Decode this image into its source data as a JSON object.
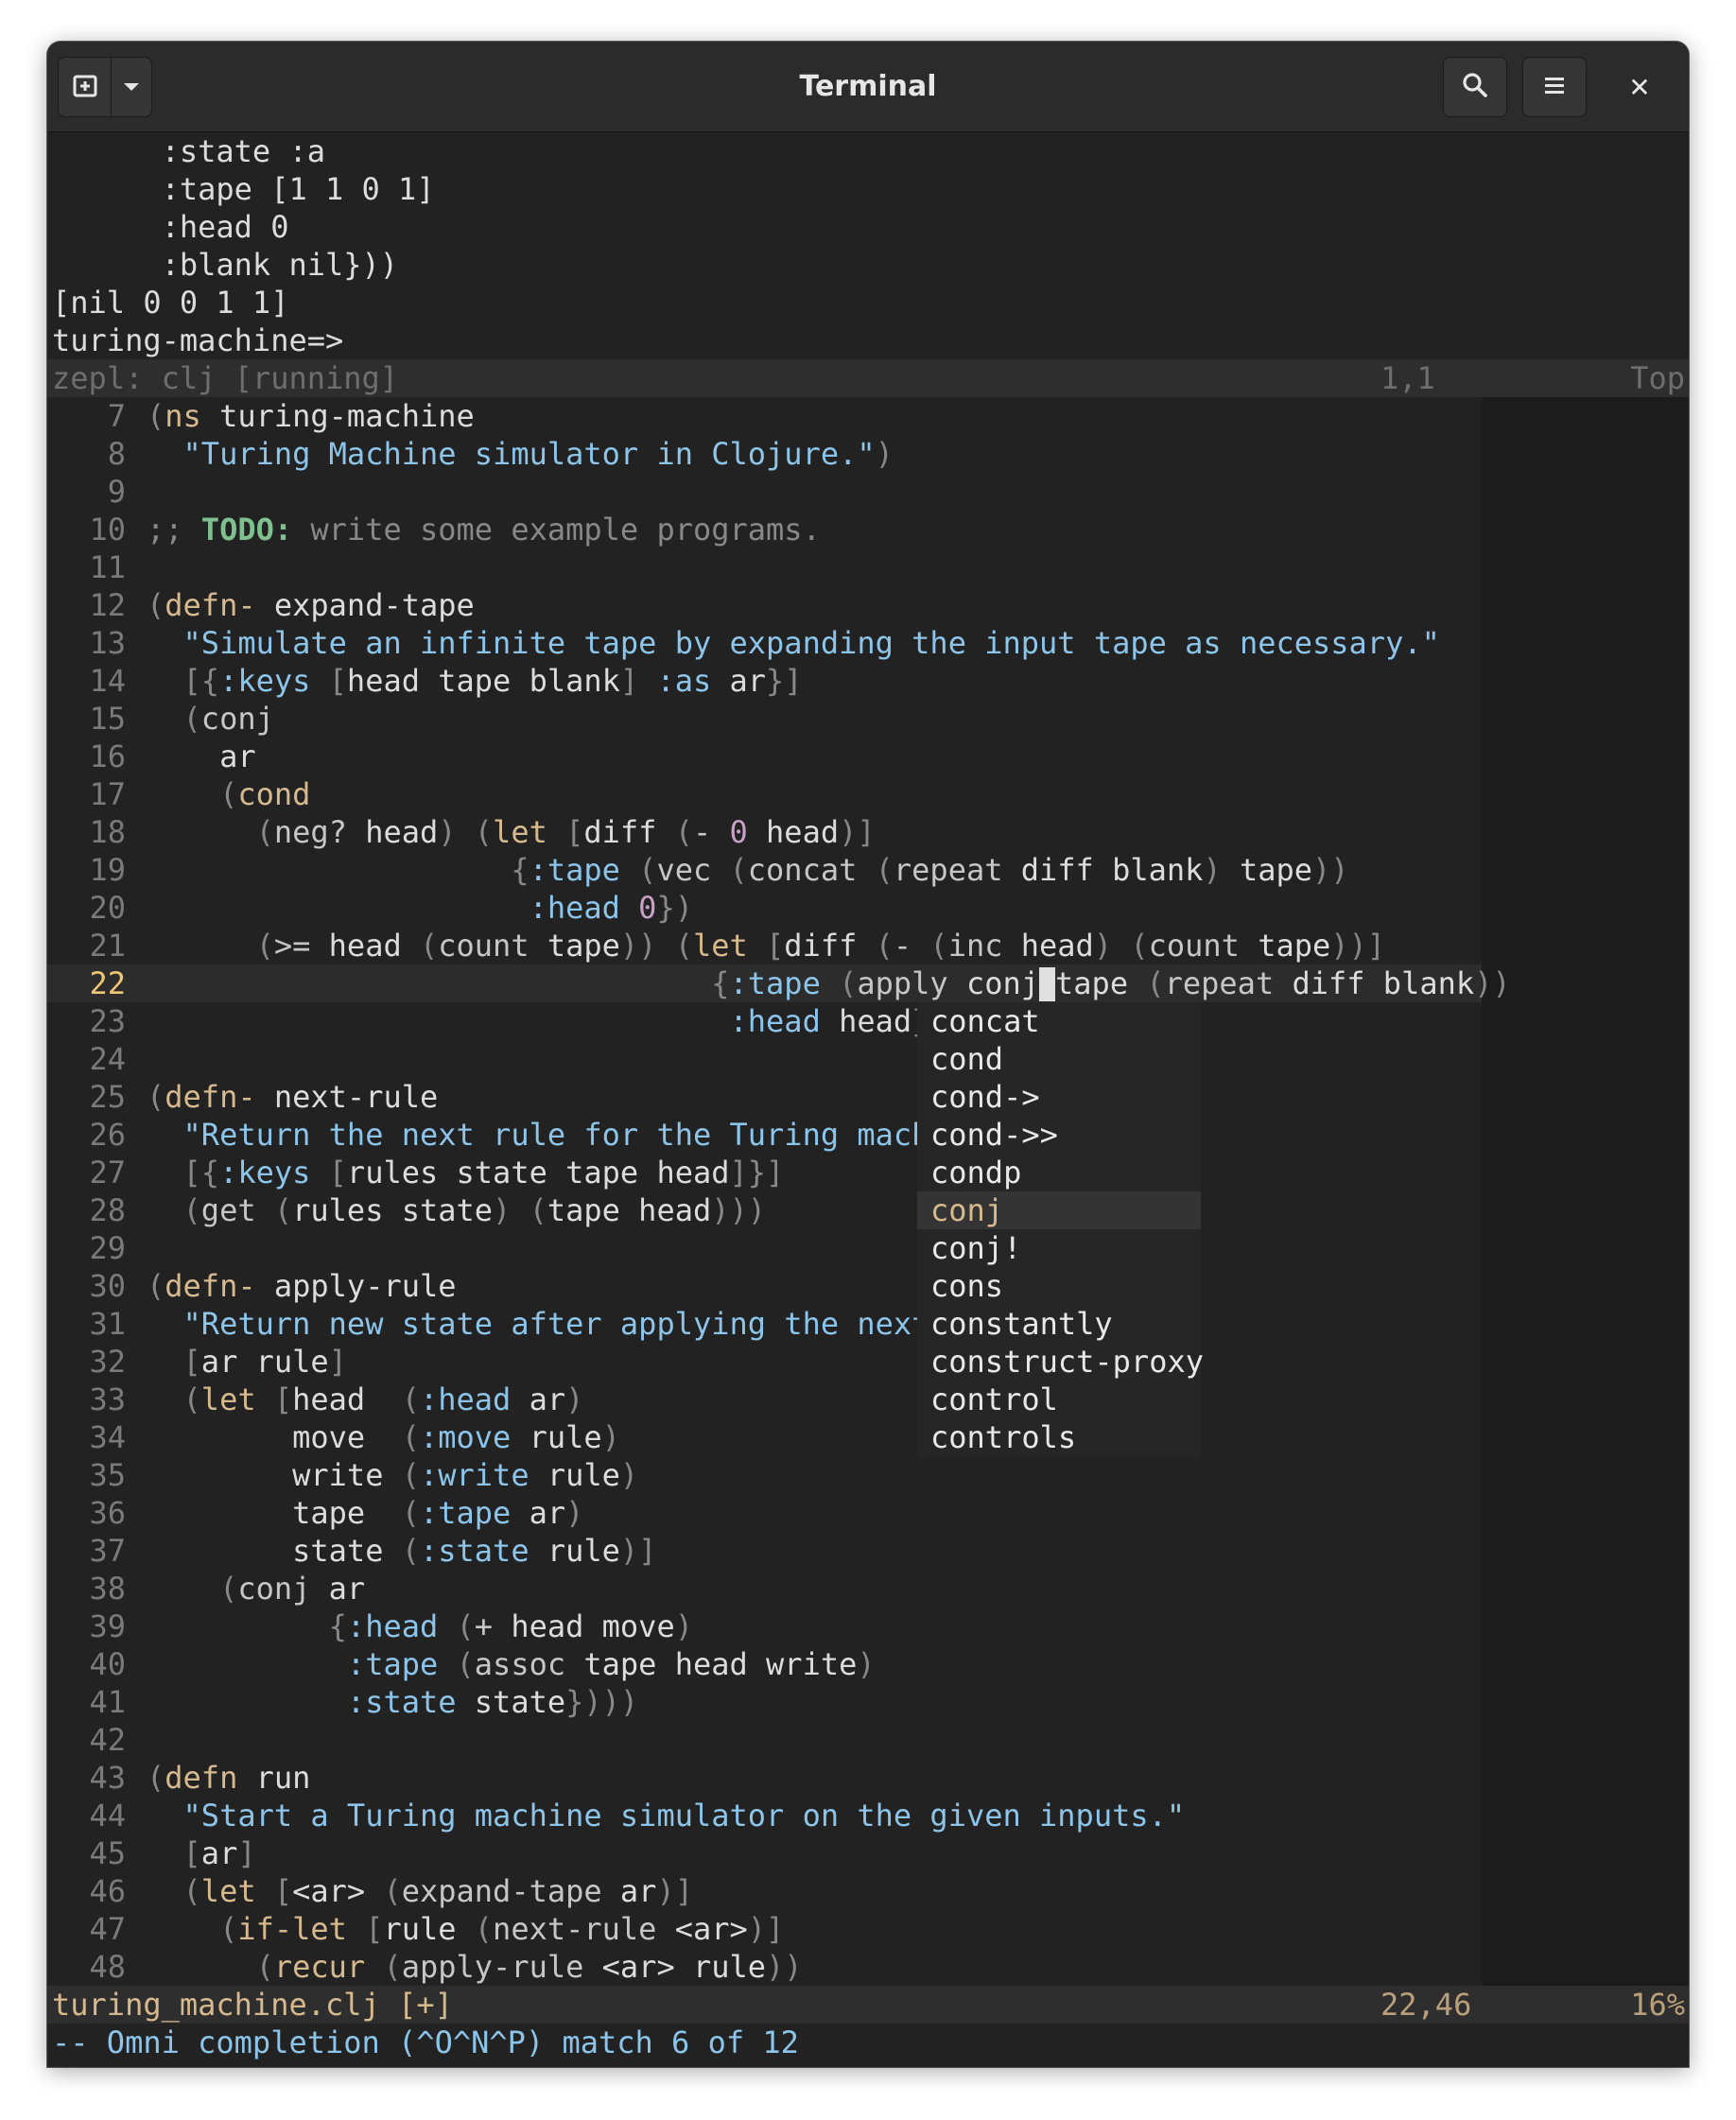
{
  "window": {
    "title": "Terminal",
    "buttons": {
      "new_tab_icon": "new-tab-icon",
      "dropdown_icon": "chevron-down-icon",
      "search_icon": "search-icon",
      "menu_icon": "hamburger-menu-icon",
      "close_label": "✕"
    }
  },
  "repl": {
    "lines": [
      "      :state :a",
      "      :tape [1 1 0 1]",
      "      :head 0",
      "      :blank nil}))",
      "[nil 0 0 1 1]",
      "turing-machine=>"
    ],
    "status": {
      "left": "zepl: clj [running]",
      "pos": "1,1",
      "right": "Top"
    }
  },
  "editor": {
    "file_status": {
      "left": "turing_machine.clj [+]",
      "pos": "22,46",
      "right": "16%"
    },
    "command_line": "-- Omni completion (^O^N^P) match 6 of 12",
    "current_line": "22",
    "lines": [
      {
        "n": "7"
      },
      {
        "n": "8"
      },
      {
        "n": "9"
      },
      {
        "n": "10"
      },
      {
        "n": "11"
      },
      {
        "n": "12"
      },
      {
        "n": "13"
      },
      {
        "n": "14"
      },
      {
        "n": "15"
      },
      {
        "n": "16"
      },
      {
        "n": "17"
      },
      {
        "n": "18"
      },
      {
        "n": "19"
      },
      {
        "n": "20"
      },
      {
        "n": "21"
      },
      {
        "n": "22"
      },
      {
        "n": "23"
      },
      {
        "n": "24"
      },
      {
        "n": "25"
      },
      {
        "n": "26"
      },
      {
        "n": "27"
      },
      {
        "n": "28"
      },
      {
        "n": "29"
      },
      {
        "n": "30"
      },
      {
        "n": "31"
      },
      {
        "n": "32"
      },
      {
        "n": "33"
      },
      {
        "n": "34"
      },
      {
        "n": "35"
      },
      {
        "n": "36"
      },
      {
        "n": "37"
      },
      {
        "n": "38"
      },
      {
        "n": "39"
      },
      {
        "n": "40"
      },
      {
        "n": "41"
      },
      {
        "n": "42"
      },
      {
        "n": "43"
      },
      {
        "n": "44"
      },
      {
        "n": "45"
      },
      {
        "n": "46"
      },
      {
        "n": "47"
      },
      {
        "n": "48"
      }
    ],
    "code": {
      "l7_ns": "ns",
      "l7_name": " turing-machine",
      "l8_str": "\"Turing Machine simulator in Clojure.\"",
      "l10_cm": ";; ",
      "l10_todo": "TODO:",
      "l10_rest": " write some example programs.",
      "defn_priv": "defn-",
      "defn": "defn",
      "l12_name": " expand-tape",
      "l13_str": "\"Simulate an infinite tape by expanding the input tape as necessary.\"",
      "kw_keys": ":keys",
      "kw_as": ":as",
      "kw_tape": ":tape",
      "kw_head": ":head",
      "kw_move": ":move",
      "kw_write": ":write",
      "kw_state": ":state",
      "l14_args": "head tape blank",
      "l14_ar": " ar",
      "conj": "conj",
      "ar": "ar",
      "cond": "cond",
      "l18_a": "neg?",
      "l18_b": " head",
      "let": "let",
      "diff": "diff",
      "minus": "-",
      "zero": "0",
      "head": "head",
      "vec": "vec",
      "concat": "concat",
      "repeat": "repeat",
      "diff_blank": " diff blank",
      "tape": "tape",
      "gte": ">=",
      "count": "count",
      "inc": "inc",
      "apply": "apply",
      "l22_conj": "conj",
      "l22_tape": "tape",
      "l25_name": " next-rule",
      "l26_str": "\"Return the next rule for the Turing machi",
      "l27_args": "rules state tape head",
      "get": "get",
      "rules_state": "rules state",
      "tape_head": "tape head",
      "l30_name": " apply-rule",
      "l31_str": "\"Return new state after applying the next",
      "l32_args": "ar rule",
      "move": "move",
      "write": "write",
      "state": "state",
      "rule": "rule",
      "plus": "+",
      "head_move": " head move",
      "assoc": "assoc",
      "assoc_args": " tape head write",
      "l43_name": " run",
      "l44_str": "\"Start a Turing machine simulator on the given inputs.\"",
      "ar_arg": "<ar>",
      "expand_tape": "expand-tape",
      "if_let": "if-let",
      "next_rule": "next-rule",
      "recur": "recur",
      "apply_rule": "apply-rule",
      "ar_rule": " <ar> rule"
    }
  },
  "completion": {
    "items": [
      "concat",
      "cond",
      "cond->",
      "cond->>",
      "condp",
      "conj",
      "conj!",
      "cons",
      "constantly",
      "construct-proxy",
      "control",
      "controls"
    ],
    "selected_index": 5
  }
}
